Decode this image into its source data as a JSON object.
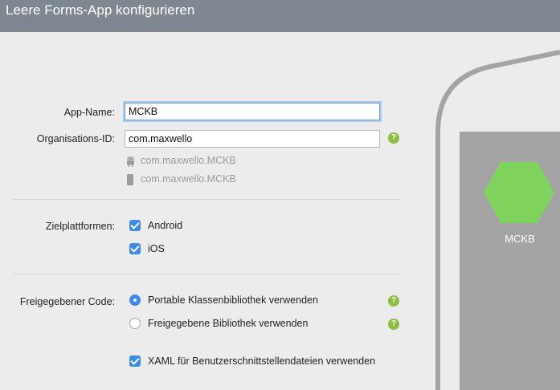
{
  "window": {
    "title": "Leere Forms-App konfigurieren"
  },
  "form": {
    "app_name": {
      "label": "App-Name:",
      "value": "MCKB"
    },
    "org_id": {
      "label": "Organisations-ID:",
      "value": "com.maxwello",
      "help": "?"
    },
    "bundle_ids": [
      {
        "platform_icon": "android-icon",
        "value": "com.maxwello.MCKB"
      },
      {
        "platform_icon": "phone-icon",
        "value": "com.maxwello.MCKB"
      }
    ],
    "platforms": {
      "label": "Zielplattformen:",
      "android": {
        "label": "Android",
        "checked": true
      },
      "ios": {
        "label": "iOS",
        "checked": true
      }
    },
    "shared_code": {
      "label": "Freigegebener Code:",
      "pcl": {
        "label": "Portable Klassenbibliothek verwenden",
        "selected": true,
        "help": "?"
      },
      "shared": {
        "label": "Freigegebene Bibliothek verwenden",
        "selected": false,
        "help": "?"
      }
    },
    "xaml": {
      "label": "XAML für Benutzerschnittstellendateien verwenden",
      "checked": true
    }
  },
  "preview": {
    "app_name": "MCKB",
    "icon_color": "#7fd35d",
    "icon_shape": "hexagon-icon"
  },
  "colors": {
    "accent": "#3b8af0",
    "help": "#8cbf3b",
    "titlebar": "#7f8891"
  }
}
